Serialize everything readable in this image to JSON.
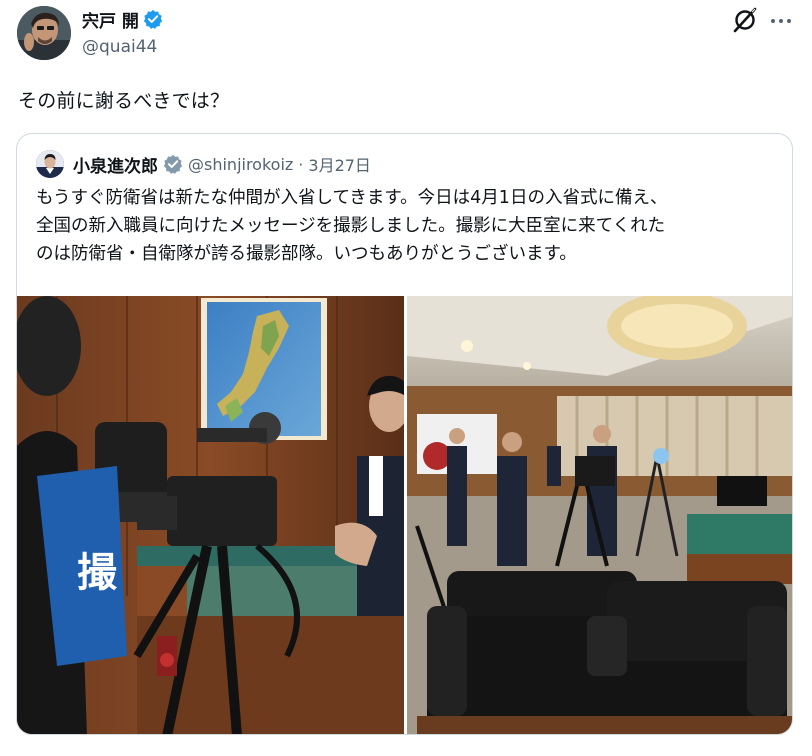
{
  "author": {
    "name": "宍戸 開",
    "handle": "@quai44",
    "verified_color": "#1d9bf0"
  },
  "post": {
    "text": "その前に謝るべきでは？"
  },
  "quote": {
    "author_name": "小泉進次郎",
    "handle": "@shinjirokoiz",
    "separator": "·",
    "date": "3月27日",
    "text": "もうすぐ防衛省は新たな仲間が入省してきます。今日は4月1日の入省式に備え、\n全国の新入職員に向けたメッセージを撮影しました。撮影に大臣室に来てくれた\nのは防衛省・自衛隊が誇る撮影部隊。いつもありがとうございます。"
  },
  "icons": {
    "grok": "grok-icon",
    "more": "more-icon",
    "verified": "verified-badge-icon",
    "government": "government-badge-icon"
  },
  "photos": {
    "left_vest_text": "撮"
  },
  "colors": {
    "text_primary": "#0f1419",
    "text_secondary": "#536471",
    "border": "#cfd9de",
    "accent": "#1d9bf0"
  }
}
